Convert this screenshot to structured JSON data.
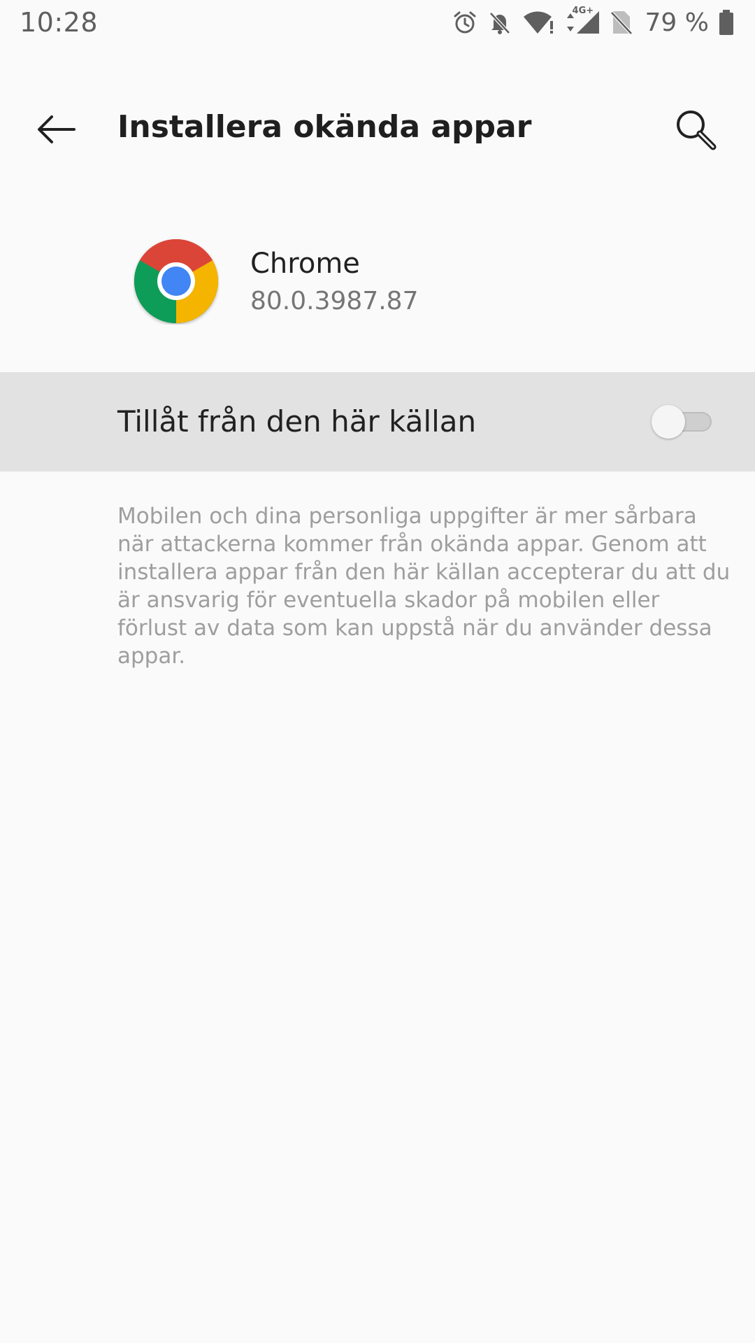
{
  "status_bar": {
    "time": "10:28",
    "battery_percent": "79 %",
    "network_type": "4G+",
    "icons": [
      "alarm-icon",
      "bell-off-icon",
      "wifi-alert-icon",
      "cellular-icon",
      "no-sim-icon",
      "battery-icon"
    ]
  },
  "toolbar": {
    "title": "Installera okända appar",
    "back_icon": "arrow-left-icon",
    "search_icon": "search-icon"
  },
  "app": {
    "name": "Chrome",
    "version": "80.0.3987.87",
    "icon": "chrome-icon"
  },
  "setting": {
    "label": "Tillåt från den här källan",
    "enabled": false
  },
  "description": "Mobilen och dina personliga uppgifter är mer sårbara när attackerna kommer från okända appar. Genom att installera appar från den här källan accepterar du att du är ansvarig för eventuella skador på mobilen eller förlust av data som kan uppstå när du använder dessa appar.",
  "colors": {
    "background": "#fafafa",
    "row_highlight": "#e2e2e2",
    "primary_text": "#212121",
    "secondary_text": "#757575",
    "description_text": "#9e9e9e"
  }
}
